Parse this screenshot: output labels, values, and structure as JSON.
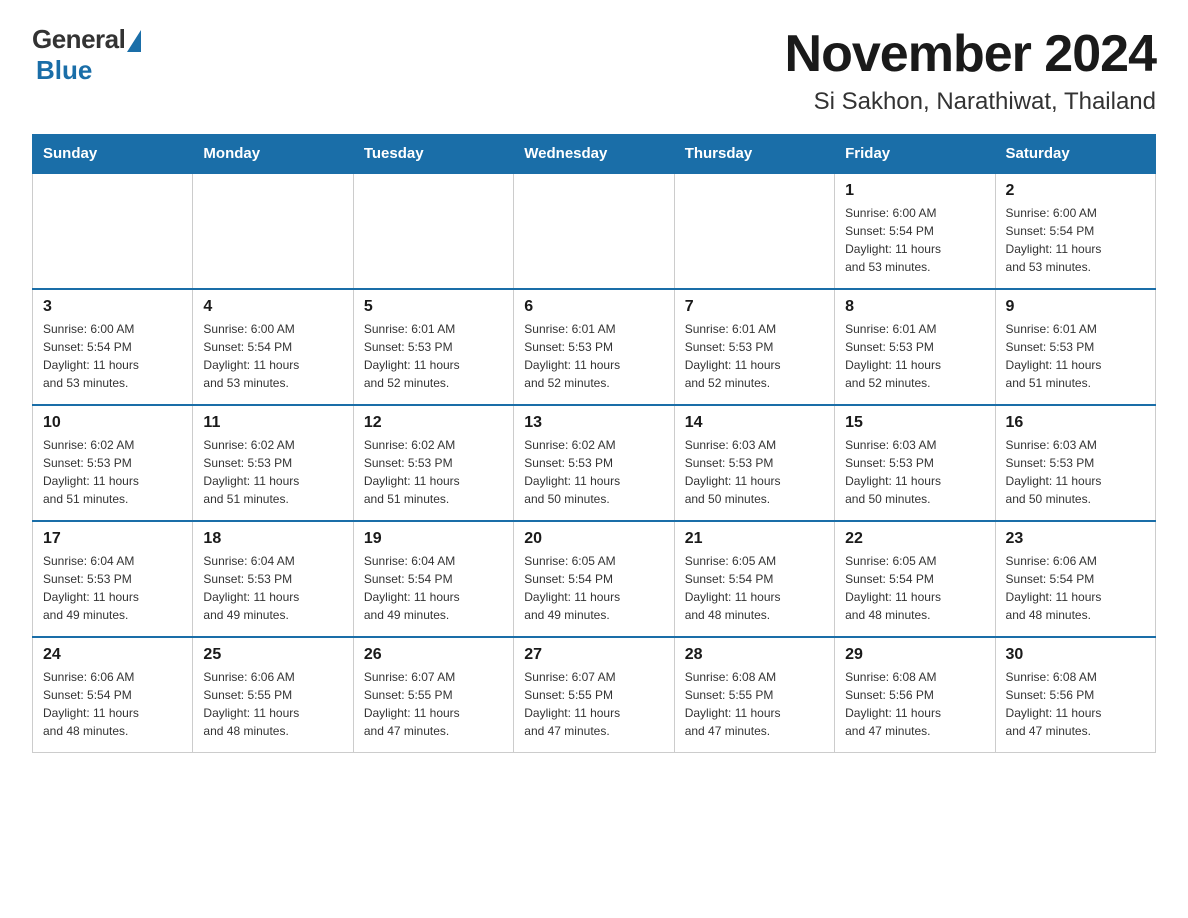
{
  "header": {
    "logo": {
      "general": "General",
      "blue": "Blue"
    },
    "title": "November 2024",
    "subtitle": "Si Sakhon, Narathiwat, Thailand"
  },
  "calendar": {
    "days_of_week": [
      "Sunday",
      "Monday",
      "Tuesday",
      "Wednesday",
      "Thursday",
      "Friday",
      "Saturday"
    ],
    "weeks": [
      [
        {
          "day": "",
          "info": ""
        },
        {
          "day": "",
          "info": ""
        },
        {
          "day": "",
          "info": ""
        },
        {
          "day": "",
          "info": ""
        },
        {
          "day": "",
          "info": ""
        },
        {
          "day": "1",
          "info": "Sunrise: 6:00 AM\nSunset: 5:54 PM\nDaylight: 11 hours\nand 53 minutes."
        },
        {
          "day": "2",
          "info": "Sunrise: 6:00 AM\nSunset: 5:54 PM\nDaylight: 11 hours\nand 53 minutes."
        }
      ],
      [
        {
          "day": "3",
          "info": "Sunrise: 6:00 AM\nSunset: 5:54 PM\nDaylight: 11 hours\nand 53 minutes."
        },
        {
          "day": "4",
          "info": "Sunrise: 6:00 AM\nSunset: 5:54 PM\nDaylight: 11 hours\nand 53 minutes."
        },
        {
          "day": "5",
          "info": "Sunrise: 6:01 AM\nSunset: 5:53 PM\nDaylight: 11 hours\nand 52 minutes."
        },
        {
          "day": "6",
          "info": "Sunrise: 6:01 AM\nSunset: 5:53 PM\nDaylight: 11 hours\nand 52 minutes."
        },
        {
          "day": "7",
          "info": "Sunrise: 6:01 AM\nSunset: 5:53 PM\nDaylight: 11 hours\nand 52 minutes."
        },
        {
          "day": "8",
          "info": "Sunrise: 6:01 AM\nSunset: 5:53 PM\nDaylight: 11 hours\nand 52 minutes."
        },
        {
          "day": "9",
          "info": "Sunrise: 6:01 AM\nSunset: 5:53 PM\nDaylight: 11 hours\nand 51 minutes."
        }
      ],
      [
        {
          "day": "10",
          "info": "Sunrise: 6:02 AM\nSunset: 5:53 PM\nDaylight: 11 hours\nand 51 minutes."
        },
        {
          "day": "11",
          "info": "Sunrise: 6:02 AM\nSunset: 5:53 PM\nDaylight: 11 hours\nand 51 minutes."
        },
        {
          "day": "12",
          "info": "Sunrise: 6:02 AM\nSunset: 5:53 PM\nDaylight: 11 hours\nand 51 minutes."
        },
        {
          "day": "13",
          "info": "Sunrise: 6:02 AM\nSunset: 5:53 PM\nDaylight: 11 hours\nand 50 minutes."
        },
        {
          "day": "14",
          "info": "Sunrise: 6:03 AM\nSunset: 5:53 PM\nDaylight: 11 hours\nand 50 minutes."
        },
        {
          "day": "15",
          "info": "Sunrise: 6:03 AM\nSunset: 5:53 PM\nDaylight: 11 hours\nand 50 minutes."
        },
        {
          "day": "16",
          "info": "Sunrise: 6:03 AM\nSunset: 5:53 PM\nDaylight: 11 hours\nand 50 minutes."
        }
      ],
      [
        {
          "day": "17",
          "info": "Sunrise: 6:04 AM\nSunset: 5:53 PM\nDaylight: 11 hours\nand 49 minutes."
        },
        {
          "day": "18",
          "info": "Sunrise: 6:04 AM\nSunset: 5:53 PM\nDaylight: 11 hours\nand 49 minutes."
        },
        {
          "day": "19",
          "info": "Sunrise: 6:04 AM\nSunset: 5:54 PM\nDaylight: 11 hours\nand 49 minutes."
        },
        {
          "day": "20",
          "info": "Sunrise: 6:05 AM\nSunset: 5:54 PM\nDaylight: 11 hours\nand 49 minutes."
        },
        {
          "day": "21",
          "info": "Sunrise: 6:05 AM\nSunset: 5:54 PM\nDaylight: 11 hours\nand 48 minutes."
        },
        {
          "day": "22",
          "info": "Sunrise: 6:05 AM\nSunset: 5:54 PM\nDaylight: 11 hours\nand 48 minutes."
        },
        {
          "day": "23",
          "info": "Sunrise: 6:06 AM\nSunset: 5:54 PM\nDaylight: 11 hours\nand 48 minutes."
        }
      ],
      [
        {
          "day": "24",
          "info": "Sunrise: 6:06 AM\nSunset: 5:54 PM\nDaylight: 11 hours\nand 48 minutes."
        },
        {
          "day": "25",
          "info": "Sunrise: 6:06 AM\nSunset: 5:55 PM\nDaylight: 11 hours\nand 48 minutes."
        },
        {
          "day": "26",
          "info": "Sunrise: 6:07 AM\nSunset: 5:55 PM\nDaylight: 11 hours\nand 47 minutes."
        },
        {
          "day": "27",
          "info": "Sunrise: 6:07 AM\nSunset: 5:55 PM\nDaylight: 11 hours\nand 47 minutes."
        },
        {
          "day": "28",
          "info": "Sunrise: 6:08 AM\nSunset: 5:55 PM\nDaylight: 11 hours\nand 47 minutes."
        },
        {
          "day": "29",
          "info": "Sunrise: 6:08 AM\nSunset: 5:56 PM\nDaylight: 11 hours\nand 47 minutes."
        },
        {
          "day": "30",
          "info": "Sunrise: 6:08 AM\nSunset: 5:56 PM\nDaylight: 11 hours\nand 47 minutes."
        }
      ]
    ]
  }
}
